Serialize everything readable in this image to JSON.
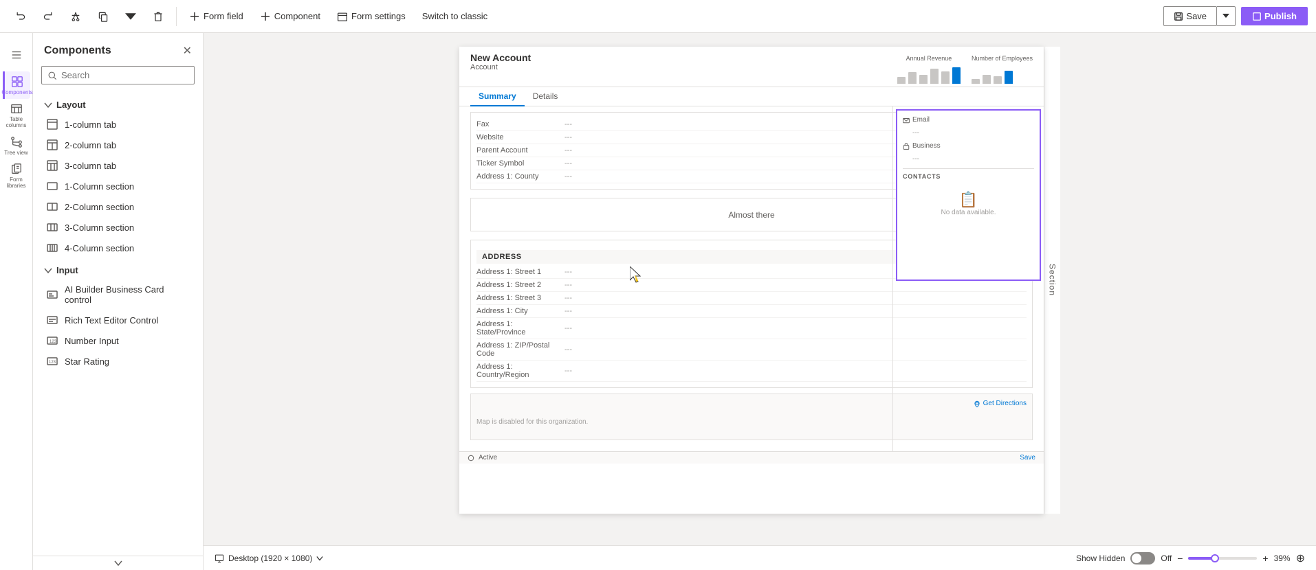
{
  "toolbar": {
    "undo_label": "Undo",
    "redo_label": "Redo",
    "cut_label": "Cut",
    "copy_label": "Copy",
    "delete_label": "Delete",
    "form_field_label": "Form field",
    "component_label": "Component",
    "form_settings_label": "Form settings",
    "switch_classic_label": "Switch to classic",
    "save_label": "Save",
    "publish_label": "Publish"
  },
  "nav": {
    "items": [
      {
        "id": "hamburger",
        "icon": "menu",
        "label": ""
      },
      {
        "id": "components",
        "icon": "components",
        "label": "Components",
        "active": true
      },
      {
        "id": "table-columns",
        "icon": "table",
        "label": "Table columns"
      },
      {
        "id": "tree-view",
        "icon": "tree",
        "label": "Tree view"
      },
      {
        "id": "form-libraries",
        "icon": "library",
        "label": "Form libraries"
      }
    ]
  },
  "panel": {
    "title": "Components",
    "search_placeholder": "Search",
    "sections": {
      "layout": {
        "label": "Layout",
        "items": [
          {
            "id": "1col-tab",
            "label": "1-column tab"
          },
          {
            "id": "2col-tab",
            "label": "2-column tab"
          },
          {
            "id": "3col-tab",
            "label": "3-column tab"
          },
          {
            "id": "1col-section",
            "label": "1-Column section"
          },
          {
            "id": "2col-section",
            "label": "2-Column section"
          },
          {
            "id": "3col-section",
            "label": "3-Column section"
          },
          {
            "id": "4col-section",
            "label": "4-Column section"
          }
        ]
      },
      "input": {
        "label": "Input",
        "items": [
          {
            "id": "ai-builder",
            "label": "AI Builder Business Card control"
          },
          {
            "id": "rich-text",
            "label": "Rich Text Editor Control"
          },
          {
            "id": "number-input",
            "label": "Number Input"
          },
          {
            "id": "star-rating",
            "label": "Star Rating"
          }
        ]
      }
    }
  },
  "form": {
    "title": "New Account",
    "subtitle": "Account",
    "tabs": [
      {
        "label": "Summary",
        "active": true
      },
      {
        "label": "Details"
      }
    ],
    "header_fields": {
      "annual_revenue_label": "Annual Revenue",
      "employees_label": "Number of Employees"
    },
    "fields": [
      {
        "label": "Fax",
        "value": "---"
      },
      {
        "label": "Website",
        "value": "---"
      },
      {
        "label": "Parent Account",
        "value": "---"
      },
      {
        "label": "Ticker Symbol",
        "value": "---"
      },
      {
        "label": "Address 1: County",
        "value": "---"
      }
    ],
    "address_section": {
      "title": "ADDRESS",
      "fields": [
        {
          "label": "Address 1: Street 1",
          "value": "---"
        },
        {
          "label": "Address 1: Street 2",
          "value": "---"
        },
        {
          "label": "Address 1: Street 3",
          "value": "---"
        },
        {
          "label": "Address 1: City",
          "value": "---"
        },
        {
          "label": "Address 1: State/Province",
          "value": "---"
        },
        {
          "label": "Address 1: ZIP/Postal Code",
          "value": "---"
        },
        {
          "label": "Address 1: Country/Region",
          "value": "---"
        }
      ]
    },
    "map_disabled_text": "Map is disabled for this organization.",
    "get_directions_label": "Get Directions",
    "almost_there_text": "Almost there",
    "status_bar": {
      "status": "Active",
      "save_label": "Save"
    },
    "right_panel": {
      "email_label": "Email",
      "business_label": "Business",
      "contacts_title": "CONTACTS",
      "no_data_text": "No data available."
    }
  },
  "bottom_bar": {
    "device_label": "Desktop (1920 × 1080)",
    "show_hidden_label": "Show Hidden",
    "toggle_state": "Off",
    "zoom_level": "39%",
    "zoom_icon": "⊕"
  },
  "right_panel": {
    "section_label": "Section"
  },
  "colors": {
    "accent": "#8b5cf6",
    "primary_blue": "#0078d4",
    "border": "#e1dfdd",
    "text_primary": "#323130",
    "text_secondary": "#605e5c",
    "text_muted": "#a19f9d"
  },
  "charts": {
    "revenue_bars": [
      30,
      50,
      40,
      70,
      55,
      80
    ],
    "employees_bars": [
      20,
      40,
      35,
      60
    ]
  }
}
